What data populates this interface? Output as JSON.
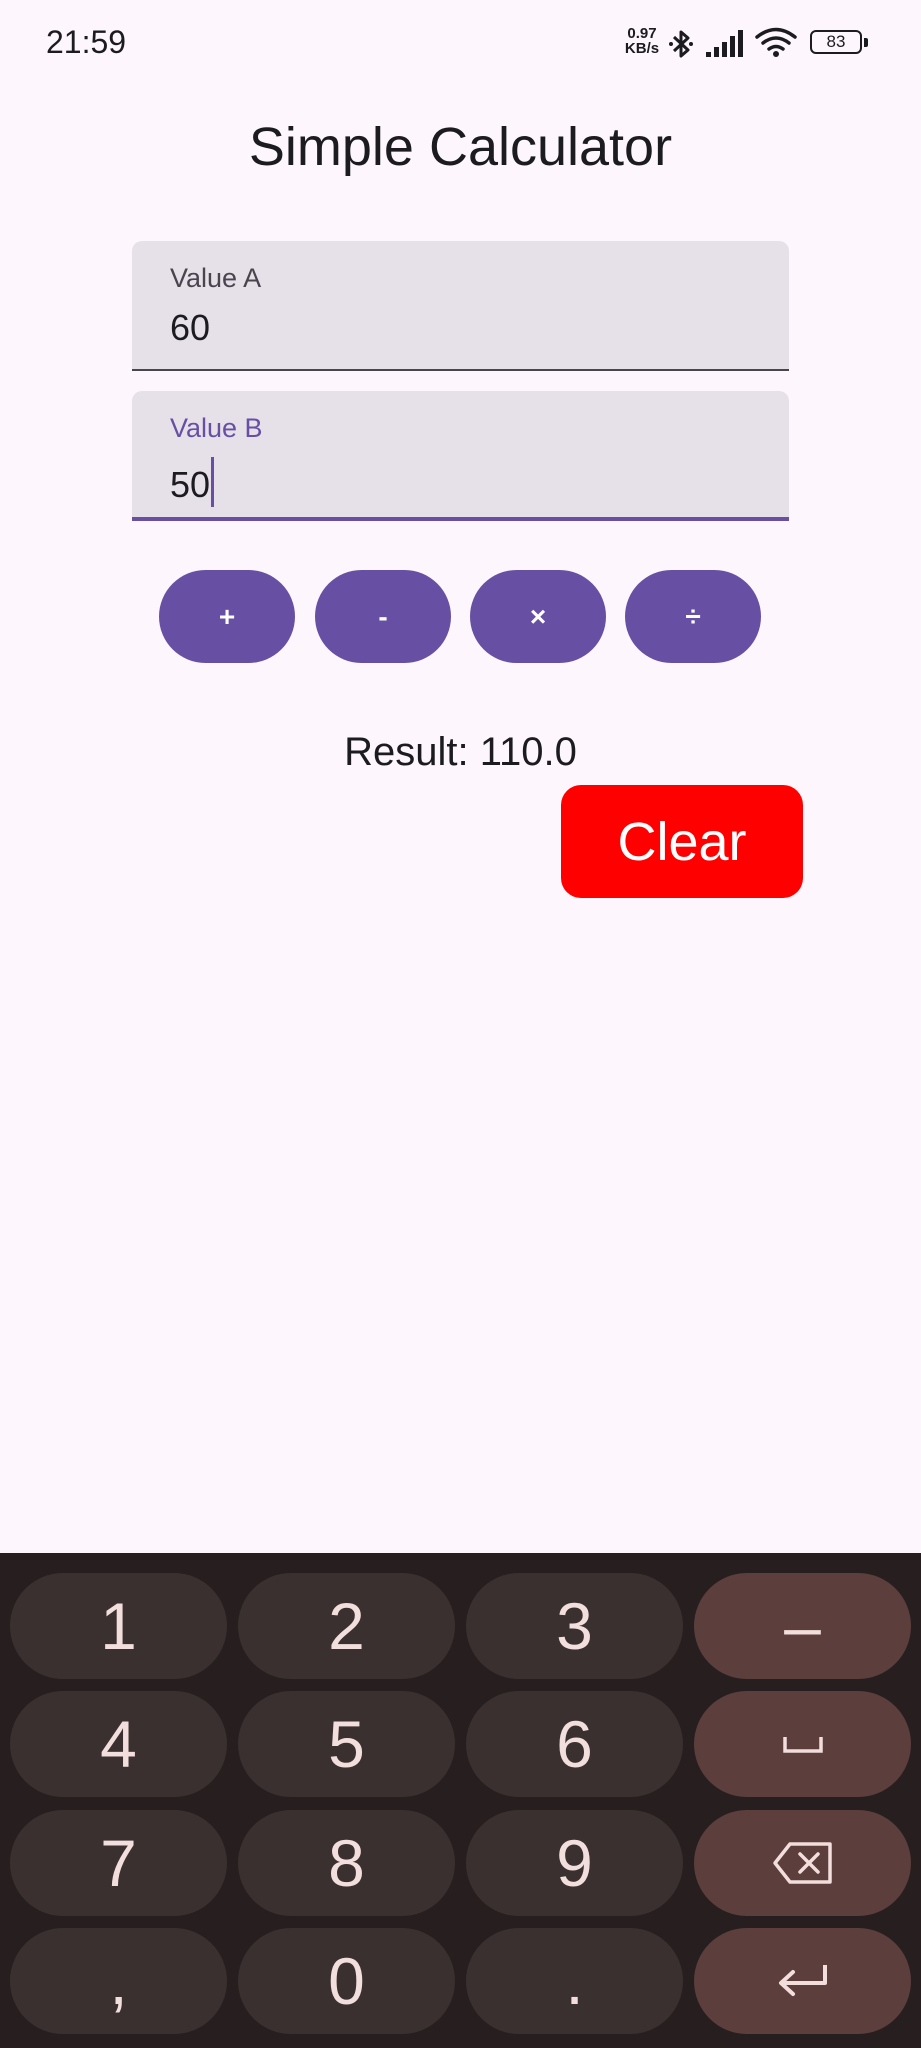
{
  "status_bar": {
    "time": "21:59",
    "net_speed_value": "0.97",
    "net_speed_unit": "KB/s",
    "battery": "83",
    "icons": [
      "bluetooth-icon",
      "signal-icon",
      "wifi-icon",
      "battery-icon"
    ]
  },
  "app": {
    "title": "Simple Calculator"
  },
  "fields": {
    "a": {
      "label": "Value A",
      "value": "60"
    },
    "b": {
      "label": "Value B",
      "value": "50"
    }
  },
  "operations": [
    "+",
    "-",
    "×",
    "÷"
  ],
  "result_text": "Result: 110.0",
  "clear_label": "Clear",
  "colors": {
    "primary": "#6750A4",
    "clear": "#FF0000",
    "background": "#FDF7FD",
    "field_fill": "#E6E0E9",
    "keyboard_bg": "#271F1F",
    "key_bg": "#3A3030",
    "key_fn_bg": "#5C3E3C"
  },
  "keyboard": {
    "keys": [
      "1",
      "2",
      "3",
      "–",
      "4",
      "5",
      "6",
      "space-icon",
      "7",
      "8",
      "9",
      "backspace-icon",
      ",",
      "0",
      ".",
      "enter-icon"
    ]
  }
}
